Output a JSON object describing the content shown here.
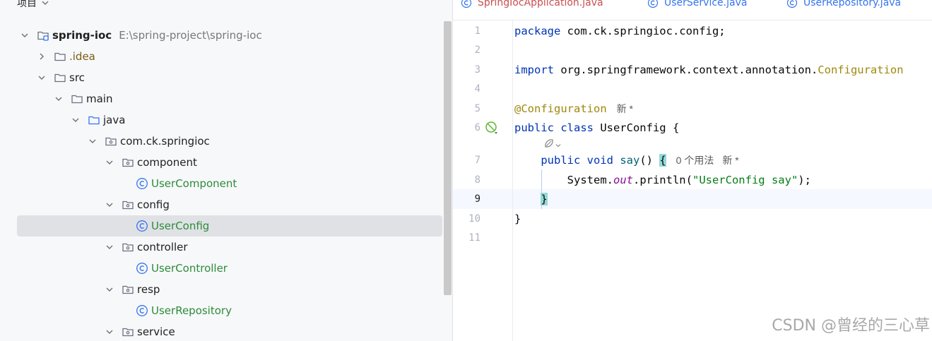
{
  "project": {
    "header": "项目",
    "root": {
      "name": "spring-ioc",
      "path": "E:\\spring-project\\spring-ioc"
    },
    "items": [
      {
        "label": ".idea",
        "kind": "folder-idea"
      },
      {
        "label": "src",
        "kind": "folder"
      },
      {
        "label": "main",
        "kind": "folder"
      },
      {
        "label": "java",
        "kind": "folder-source"
      },
      {
        "label": "com.ck.springioc",
        "kind": "package"
      },
      {
        "label": "component",
        "kind": "package"
      },
      {
        "label": "UserComponent",
        "kind": "class"
      },
      {
        "label": "config",
        "kind": "package"
      },
      {
        "label": "UserConfig",
        "kind": "class",
        "selected": true
      },
      {
        "label": "controller",
        "kind": "package"
      },
      {
        "label": "UserController",
        "kind": "class"
      },
      {
        "label": "resp",
        "kind": "package"
      },
      {
        "label": "UserRepository",
        "kind": "class"
      },
      {
        "label": "service",
        "kind": "package"
      }
    ]
  },
  "tabs": [
    {
      "label": "SpringIocApplication.java",
      "color": "#c94f4f"
    },
    {
      "label": "UserService.java",
      "color": "#3574f0"
    },
    {
      "label": "UserRepository.java",
      "color": "#3574f0"
    }
  ],
  "editor": {
    "line_numbers": [
      "1",
      "2",
      "3",
      "4",
      "5",
      "6",
      "7",
      "8",
      "9",
      "10",
      "11"
    ],
    "current_line": "9",
    "l1_kw": "package",
    "l1_rest": " com.ck.springioc.config;",
    "l3_kw": "import",
    "l3_pkg": " org.springframework.context.annotation.",
    "l3_cls": "Configuration",
    "l5_ann": "@Configuration",
    "l5_hint": "新 *",
    "l6_kw": "public class",
    "l6_rest": " UserConfig {",
    "l7_kw": "public void",
    "l7_fn": "say",
    "l7_paren": "() ",
    "l7_brace": "{",
    "l7_usage": "0 个用法",
    "l7_hint": "新 *",
    "l8_sys": "System.",
    "l8_out": "out",
    "l8_call": ".println(",
    "l8_str": "\"UserConfig say\"",
    "l8_end": ");",
    "l9_brace": "}",
    "l10_brace": "}"
  },
  "watermark": "CSDN @曾经的三心草",
  "colors": {
    "keyword": "#0033b3",
    "annotation": "#9e880d",
    "string": "#067d17",
    "class_file": "#2e8b3a",
    "selection": "#dfe1e5"
  }
}
